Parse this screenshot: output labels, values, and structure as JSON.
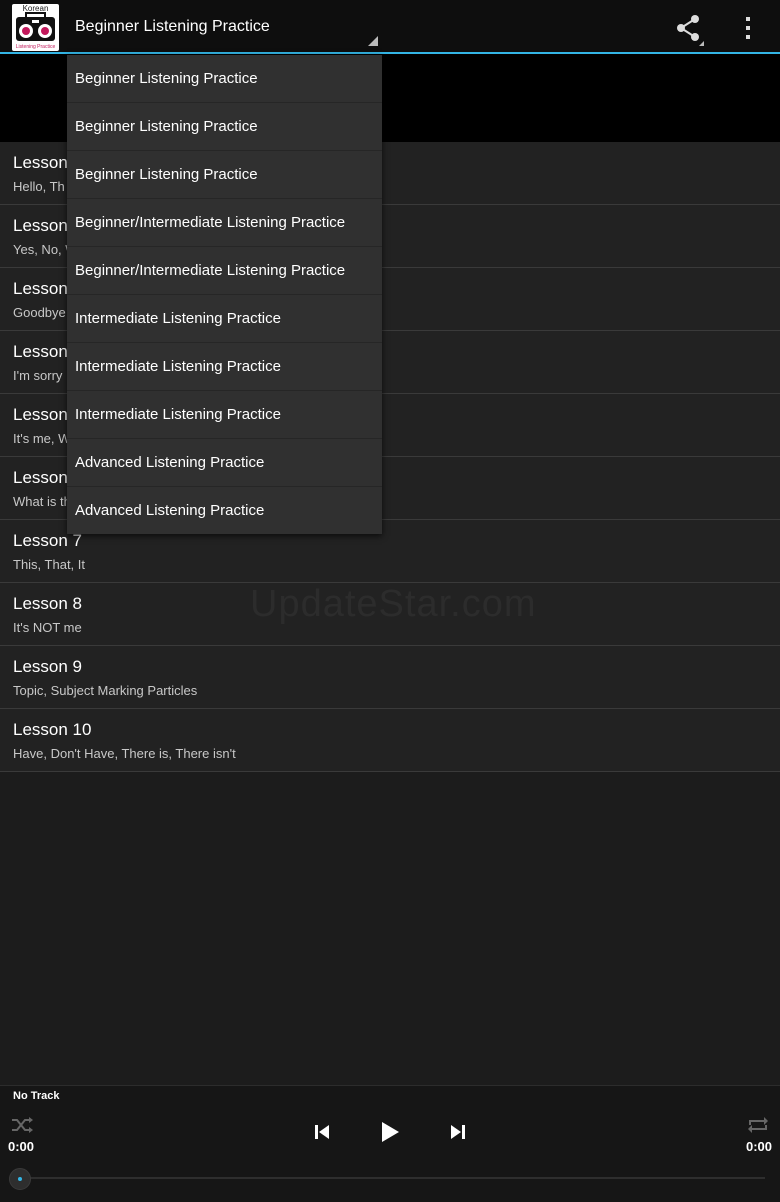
{
  "app": {
    "logo_text_top": "Korean",
    "logo_text_bottom": "Listening Practice",
    "accent_color": "#33b5e5"
  },
  "actionbar": {
    "spinner_selected": "Beginner Listening Practice",
    "share_icon": "share-icon",
    "overflow_icon": "overflow-menu-icon"
  },
  "dropdown": {
    "items": [
      {
        "label": "Beginner Listening Practice"
      },
      {
        "label": "Beginner Listening Practice"
      },
      {
        "label": "Beginner Listening Practice"
      },
      {
        "label": "Beginner/Intermediate Listening Practice"
      },
      {
        "label": "Beginner/Intermediate Listening Practice"
      },
      {
        "label": "Intermediate Listening Practice"
      },
      {
        "label": "Intermediate Listening Practice"
      },
      {
        "label": "Intermediate Listening Practice"
      },
      {
        "label": "Advanced Listening Practice"
      },
      {
        "label": "Advanced Listening Practice"
      }
    ]
  },
  "lessons": [
    {
      "title": "Lesson",
      "subtitle": "Hello, Th"
    },
    {
      "title": "Lesson",
      "subtitle": "Yes, No, W"
    },
    {
      "title": "Lesson",
      "subtitle": "Goodbye"
    },
    {
      "title": "Lesson",
      "subtitle": "I'm sorry"
    },
    {
      "title": "Lesson",
      "subtitle": "It's me, W"
    },
    {
      "title": "Lesson",
      "subtitle": "What is th"
    },
    {
      "title": "Lesson 7",
      "subtitle": "This, That, It"
    },
    {
      "title": "Lesson 8",
      "subtitle": "It's NOT me"
    },
    {
      "title": "Lesson 9",
      "subtitle": "Topic, Subject Marking Particles"
    },
    {
      "title": "Lesson 10",
      "subtitle": "Have, Don't Have, There is, There isn't"
    }
  ],
  "watermark": "UpdateStar.com",
  "player": {
    "track": "No Track",
    "time_elapsed": "0:00",
    "time_total": "0:00",
    "progress": 0,
    "icons": [
      "shuffle-icon",
      "previous-icon",
      "play-icon",
      "next-icon",
      "repeat-icon"
    ]
  }
}
